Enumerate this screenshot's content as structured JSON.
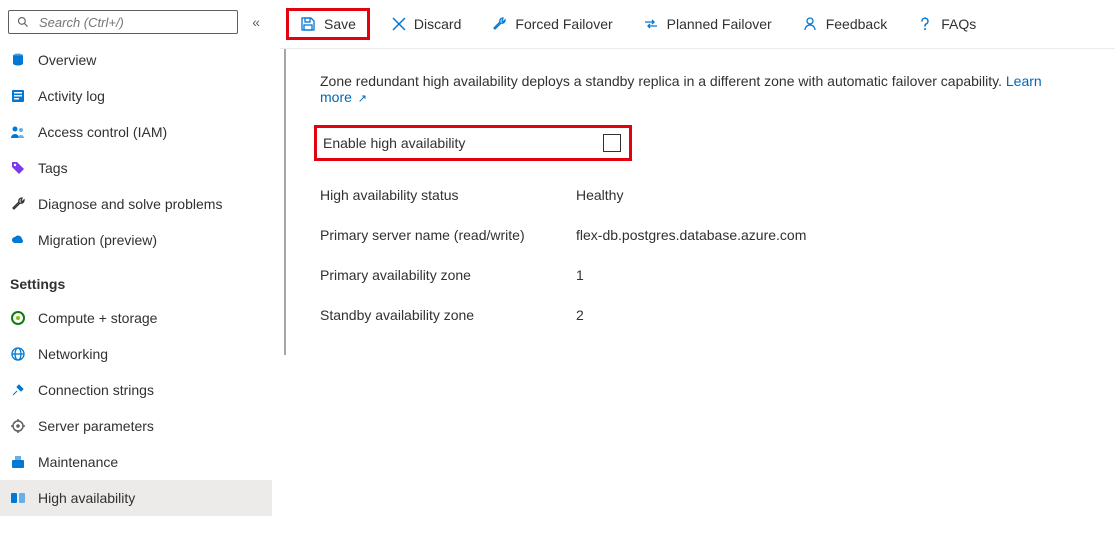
{
  "search": {
    "placeholder": "Search (Ctrl+/)"
  },
  "sidebar": {
    "items": [
      {
        "label": "Overview"
      },
      {
        "label": "Activity log"
      },
      {
        "label": "Access control (IAM)"
      },
      {
        "label": "Tags"
      },
      {
        "label": "Diagnose and solve problems"
      },
      {
        "label": "Migration (preview)"
      }
    ],
    "settingsHeader": "Settings",
    "settings": [
      {
        "label": "Compute + storage"
      },
      {
        "label": "Networking"
      },
      {
        "label": "Connection strings"
      },
      {
        "label": "Server parameters"
      },
      {
        "label": "Maintenance"
      },
      {
        "label": "High availability"
      }
    ]
  },
  "toolbar": {
    "save": "Save",
    "discard": "Discard",
    "forced": "Forced Failover",
    "planned": "Planned Failover",
    "feedback": "Feedback",
    "faqs": "FAQs"
  },
  "main": {
    "desc_text": "Zone redundant high availability deploys a standby replica in a different zone with automatic failover capability. ",
    "learn_more": "Learn more",
    "enable_label": "Enable high availability",
    "rows": {
      "status_label": "High availability status",
      "status_value": "Healthy",
      "primary_name_label": "Primary server name (read/write)",
      "primary_name_value": "flex-db.postgres.database.azure.com",
      "primary_zone_label": "Primary availability zone",
      "primary_zone_value": "1",
      "standby_zone_label": "Standby availability zone",
      "standby_zone_value": "2"
    }
  }
}
